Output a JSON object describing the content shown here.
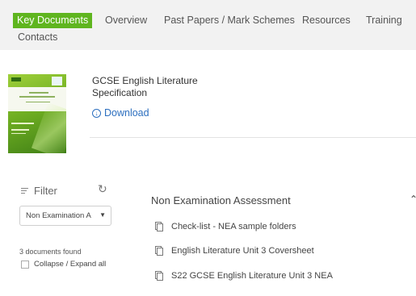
{
  "nav": {
    "tabs": [
      {
        "label": "Key Documents",
        "active": true
      },
      {
        "label": "Overview",
        "active": false
      },
      {
        "label": "Past Papers / Mark Schemes",
        "active": false
      },
      {
        "label": "Resources",
        "active": false
      },
      {
        "label": "Training",
        "active": false
      },
      {
        "label": "Contacts",
        "active": false
      }
    ],
    "accent_color": "#5fb51f"
  },
  "document": {
    "title": "GCSE English Literature Specification",
    "download_label": "Download",
    "link_color": "#2c6fbf"
  },
  "filter": {
    "label": "Filter",
    "selected": "Non Examination A",
    "found_text": "3 documents found",
    "collapse_label": "Collapse / Expand all"
  },
  "section": {
    "title": "Non Examination Assessment",
    "items": [
      {
        "label": "Check-list - NEA sample folders"
      },
      {
        "label": "English Literature Unit 3 Coversheet"
      },
      {
        "label": "S22 GCSE English Literature Unit 3 NEA"
      }
    ]
  }
}
